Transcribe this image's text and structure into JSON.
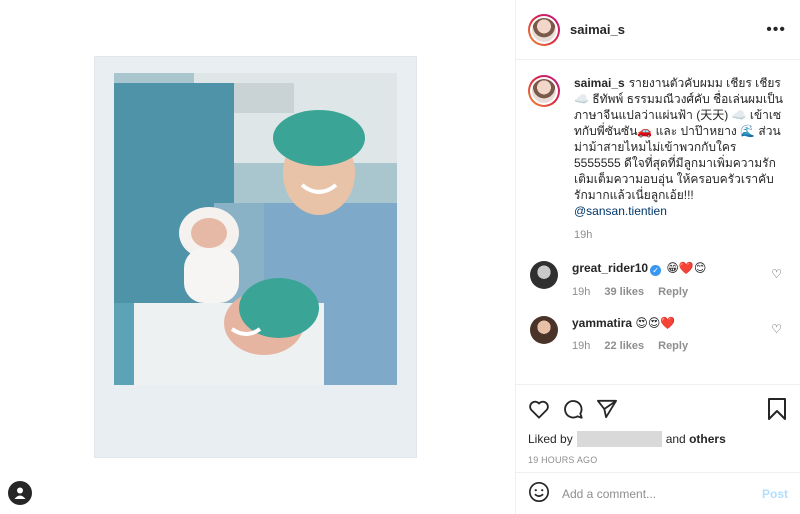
{
  "post": {
    "username": "saimai_s",
    "caption_user": "saimai_s",
    "caption_text": "รายงานตัวคับผมม เชียร เชียร ☁️ ธีทัพพ์ ธรรมมณีวงศ์คับ ชื่อเล่นผมเป็นภาษาจีนแปลว่าแผ่นฟ้า (天天) ☁️ เข้าเซทกับพี่ซันซัน🚗 และ ปาป๊าหยาง 🌊 ส่วนม่าม้าสายไหมไม่เข้าพวกกับใคร 5555555 ดีใจที่สุดที่มีลูกมาเพิ่มความรัก เติมเต็มความอบอุ่น ให้ครอบครัวเราคับ รักมากแล้วเนี่ยลูกเอ้ย!!! ",
    "caption_mention": "@sansan.tientien",
    "caption_time": "19h"
  },
  "comments": [
    {
      "username": "great_rider10",
      "text": "😁❤️😊",
      "time": "19h",
      "likes": "39 likes",
      "reply": "Reply",
      "avatar_color": "#3a3a3a"
    },
    {
      "username": "yammatira",
      "text": "😍😍❤️",
      "time": "19h",
      "likes": "22 likes",
      "reply": "Reply",
      "avatar_color": "#6b4a3a"
    }
  ],
  "actions": {
    "liked_by_prefix": "Liked by",
    "liked_by_connector": "and",
    "liked_by_others": "others",
    "time_ago": "19 HOURS AGO"
  },
  "composer": {
    "placeholder": "Add a comment...",
    "post_label": "Post"
  },
  "icons": {
    "more": "more-icon",
    "like": "heart-icon",
    "comment": "comment-icon",
    "share": "share-icon",
    "save": "bookmark-icon",
    "emoji": "emoji-icon",
    "verified": "verified-icon",
    "user": "user-icon"
  },
  "colors": {
    "link": "#00376b",
    "verified": "#3897f0",
    "post_disabled": "#b2dffc",
    "muted": "#8e8e8e"
  }
}
